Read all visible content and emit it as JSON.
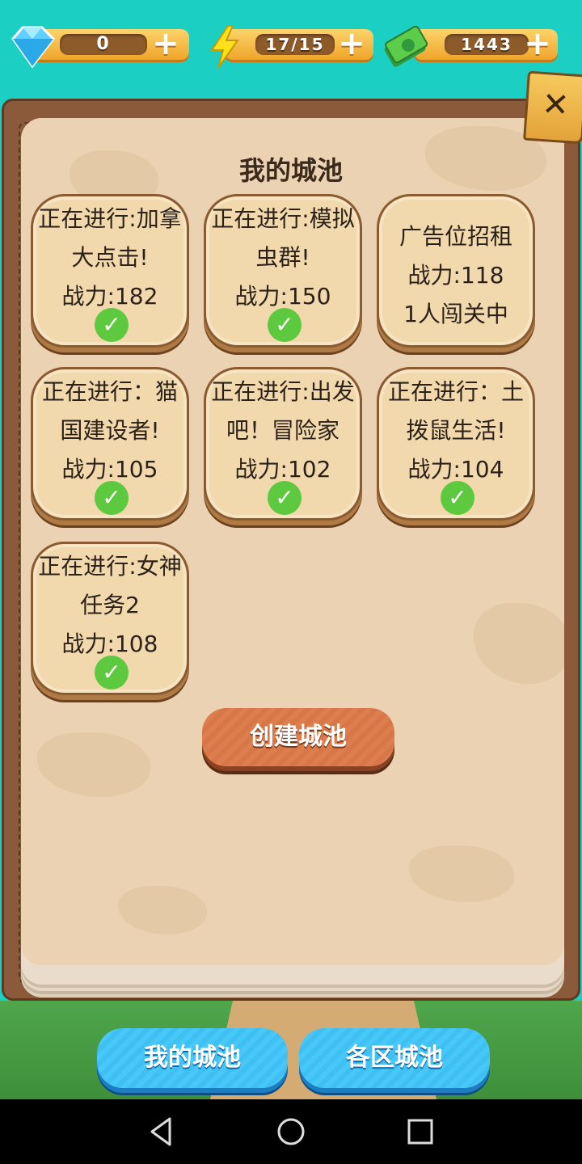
{
  "resources": {
    "gems": "0",
    "energy": "17/15",
    "cash": "1443"
  },
  "title": "我的城池",
  "cards": [
    {
      "text": "正在进行:加拿大点击!",
      "power": "战力:182",
      "checked": true
    },
    {
      "text": "正在进行:模拟虫群!",
      "power": "战力:150",
      "checked": true
    },
    {
      "line1": "广告位招租",
      "power": "战力:118",
      "line3": "1人闯关中",
      "checked": false
    },
    {
      "text": "正在进行：猫国建设者!",
      "power": "战力:105",
      "checked": true
    },
    {
      "text": "正在进行:出发吧！冒险家",
      "power": "战力:102",
      "checked": true
    },
    {
      "text": "正在进行：土拨鼠生活!",
      "power": "战力:104",
      "checked": true
    },
    {
      "text": "正在进行:女神任务2",
      "power": "战力:108",
      "checked": true
    }
  ],
  "create_button": "创建城池",
  "tabs": {
    "mine": "我的城池",
    "regions": "各区城池"
  },
  "icons": {
    "gem": "diamond-icon",
    "energy": "lightning-icon",
    "cash": "money-icon",
    "close": "close-icon",
    "check": "check-icon"
  }
}
